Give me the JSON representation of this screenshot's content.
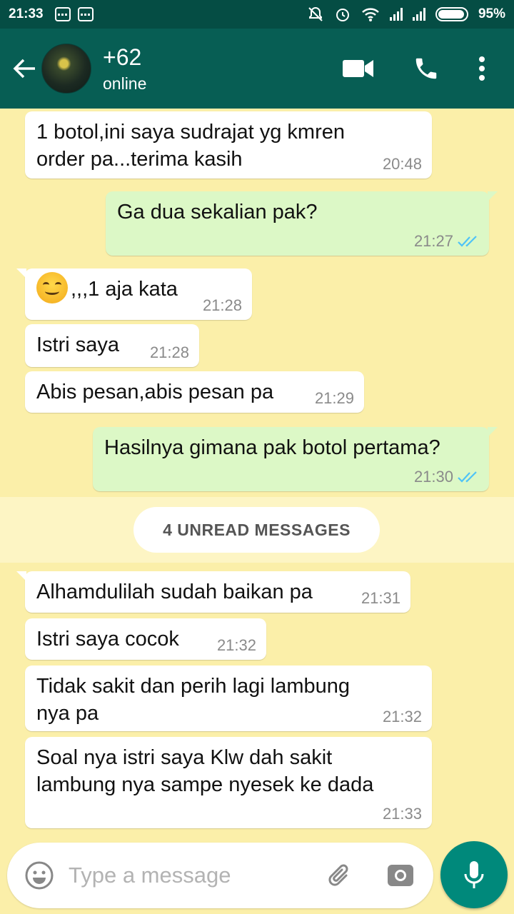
{
  "statusbar": {
    "time": "21:33",
    "battery": "95%",
    "battery_level": 0.95
  },
  "header": {
    "contact_name": "+62",
    "contact_status": "online"
  },
  "messages": [
    {
      "dir": "in",
      "text_lines": [
        "1 botol,ini saya sudrajat yg kmren",
        "order pa...terima kasih"
      ],
      "time": "20:48"
    },
    {
      "dir": "out",
      "text": "Ga dua sekalian pak?",
      "time": "21:27",
      "ticks": "read"
    },
    {
      "dir": "in",
      "text": ",,,1 aja kata",
      "emoji": "smiling-face",
      "time": "21:28"
    },
    {
      "dir": "in",
      "text": "Istri saya",
      "time": "21:28"
    },
    {
      "dir": "in",
      "text": "Abis pesan,abis pesan pa",
      "time": "21:29"
    },
    {
      "dir": "out",
      "text": "Hasilnya gimana pak botol pertama?",
      "time": "21:30",
      "ticks": "read"
    },
    {
      "dir": "in",
      "text": "Alhamdulilah sudah baikan pa",
      "time": "21:31"
    },
    {
      "dir": "in",
      "text": "Istri saya cocok",
      "time": "21:32"
    },
    {
      "dir": "in",
      "text_lines": [
        "Tidak sakit dan perih lagi lambung",
        "nya pa"
      ],
      "time": "21:32"
    },
    {
      "dir": "in",
      "text_lines": [
        "Soal nya istri saya Klw dah sakit",
        "lambung nya sampe nyesek ke dada"
      ],
      "time": "21:33"
    }
  ],
  "unread_label": "4 UNREAD MESSAGES",
  "composer": {
    "placeholder": "Type a message"
  },
  "icons": [
    "back-arrow-icon",
    "video-call-icon",
    "phone-icon",
    "more-vert-icon",
    "emoji-icon",
    "attach-icon",
    "camera-icon",
    "mic-icon",
    "double-check-icon"
  ],
  "colors": {
    "header": "#075e54",
    "statusbar": "#054d44",
    "outgoing": "#dcf8c6",
    "incoming": "#ffffff",
    "wallpaper": "#fbefa9",
    "read_ticks": "#4fc3f7",
    "mic_button": "#00897b"
  }
}
